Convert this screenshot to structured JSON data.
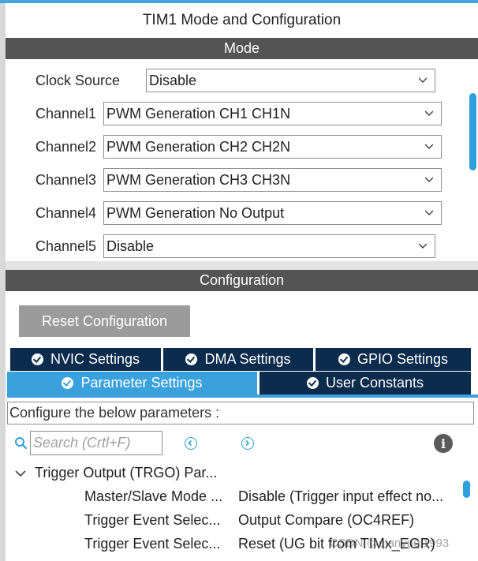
{
  "window": {
    "title": "TIM1 Mode and Configuration"
  },
  "mode_section": {
    "header": "Mode",
    "rows": [
      {
        "label": "Clock Source",
        "value": "Disable"
      },
      {
        "label": "Channel1",
        "value": "PWM Generation CH1 CH1N"
      },
      {
        "label": "Channel2",
        "value": "PWM Generation CH2 CH2N"
      },
      {
        "label": "Channel3",
        "value": "PWM Generation CH3 CH3N"
      },
      {
        "label": "Channel4",
        "value": "PWM Generation No Output"
      },
      {
        "label": "Channel5",
        "value": "Disable"
      }
    ]
  },
  "config_section": {
    "header": "Configuration",
    "reset_button": "Reset Configuration",
    "tabs_row1": [
      "NVIC Settings",
      "DMA Settings",
      "GPIO Settings"
    ],
    "tabs_row2": [
      "Parameter Settings",
      "User Constants"
    ],
    "active_tab": "Parameter Settings",
    "description": "Configure the below parameters :",
    "search_placeholder": "Search (Crtl+F)"
  },
  "params": {
    "group": "Trigger Output (TRGO) Par...",
    "items": [
      {
        "name": "Master/Slave Mode ...",
        "value": "Disable (Trigger input effect no..."
      },
      {
        "name": "Trigger Event Selec...",
        "value": "Output Compare (OC4REF)"
      },
      {
        "name": "Trigger Event Selec...",
        "value": "Reset (UG bit from TIMx_EGR)"
      }
    ]
  },
  "watermark": "CSDN @qianyuqi1993",
  "colors": {
    "accent": "#3aa1dd",
    "tab_dark": "#0c2c4d",
    "section_bar": "#545454",
    "reset_button": "#9b9b9b"
  },
  "icons": [
    "chevron-down-icon",
    "check-circle-icon",
    "search-icon",
    "prev-match-icon",
    "next-match-icon",
    "info-icon",
    "expand-chevron-icon"
  ]
}
